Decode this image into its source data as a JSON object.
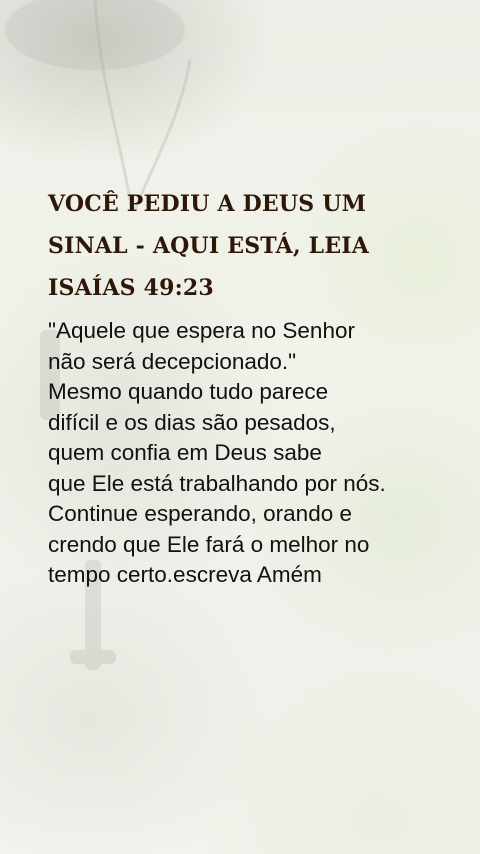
{
  "title_lines": [
    "VOCÊ PEDIU A DEUS UM",
    "SINAL - AQUI ESTÁ, LEIA",
    "ISAÍAS 49:23"
  ],
  "body_lines": [
    "\"Aquele que espera no Senhor",
    "não será decepcionado.\"",
    "Mesmo quando tudo parece",
    "difícil e os dias são pesados,",
    "quem confia em Deus sabe",
    "que Ele está trabalhando por nós.",
    "Continue esperando, orando e",
    "crendo que Ele fará o melhor no",
    "tempo certo.escreva Amém"
  ],
  "colors": {
    "title": "#2f1708",
    "body": "#111111",
    "background": "#eef0ea"
  }
}
